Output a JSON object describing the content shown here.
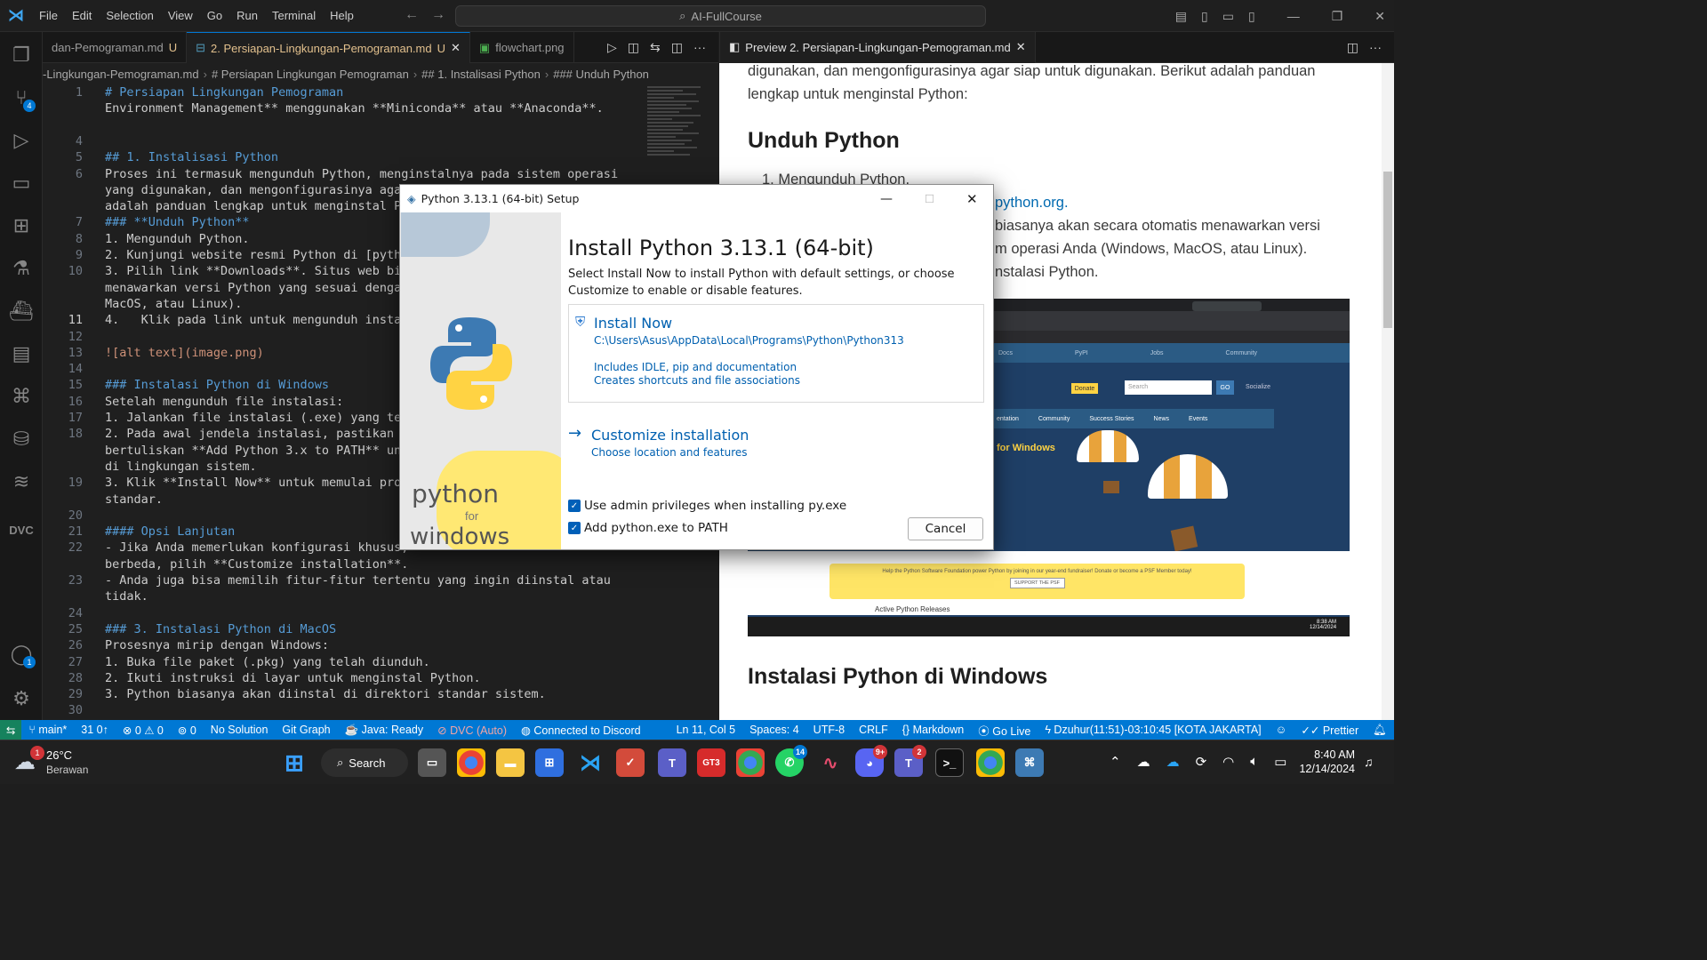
{
  "titlebar": {
    "menus": [
      "File",
      "Edit",
      "Selection",
      "View",
      "Go",
      "Run",
      "Terminal",
      "Help"
    ],
    "command_center": "AI-FullCourse"
  },
  "activity": {
    "scm_badge": "4",
    "account_badge": "1"
  },
  "editor_tabs": [
    {
      "label": "dan-Pemograman.md",
      "modified": "U",
      "active": false
    },
    {
      "label": "2. Persiapan-Lingkungan-Pemograman.md",
      "modified": "U",
      "active": true
    },
    {
      "label": "flowchart.png",
      "modified": "",
      "active": false
    }
  ],
  "breadcrumb": [
    "-Lingkungan-Pemograman.md",
    "# Persiapan Lingkungan Pemograman",
    "## 1. Instalisasi Python",
    "### Unduh Python"
  ],
  "editor": {
    "lines": [
      {
        "n": "1",
        "t": "# Persiapan Lingkungan Pemograman",
        "k": "h"
      },
      {
        "n": "",
        "t": "Environment Management** menggunakan **Miniconda** atau **Anaconda**.",
        "k": "mix1"
      },
      {
        "n": "",
        "t": "",
        "k": ""
      },
      {
        "n": "4",
        "t": "",
        "k": ""
      },
      {
        "n": "5",
        "t": "## 1. Instalisasi Python",
        "k": "h"
      },
      {
        "n": "6",
        "t": "Proses ini termasuk mengunduh Python, menginstalnya pada sistem operasi",
        "k": ""
      },
      {
        "n": "",
        "t": "yang digunakan, dan mengonfigurasinya agar siap untuk digunakan. Berikut",
        "k": ""
      },
      {
        "n": "",
        "t": "adalah panduan lengkap untuk menginstal Py",
        "k": ""
      },
      {
        "n": "7",
        "t": "### **Unduh Python**",
        "k": "h"
      },
      {
        "n": "8",
        "t": "1. Mengunduh Python.",
        "k": "li"
      },
      {
        "n": "9",
        "t": "2. Kunjungi website resmi Python di [pytho",
        "k": "li"
      },
      {
        "n": "10",
        "t": "3. Pilih link **Downloads**. Situs web bia",
        "k": "li"
      },
      {
        "n": "",
        "t": "menawarkan versi Python yang sesuai dengan",
        "k": ""
      },
      {
        "n": "",
        "t": "MacOS, atau Linux).",
        "k": ""
      },
      {
        "n": "11",
        "t": "4.   Klik pada link untuk mengunduh instal",
        "k": "li"
      },
      {
        "n": "12",
        "t": "",
        "k": ""
      },
      {
        "n": "13",
        "t": "![alt text](image.png)",
        "k": "img"
      },
      {
        "n": "14",
        "t": "",
        "k": ""
      },
      {
        "n": "15",
        "t": "### Instalasi Python di Windows",
        "k": "h"
      },
      {
        "n": "16",
        "t": "Setelah mengunduh file instalasi:",
        "k": ""
      },
      {
        "n": "17",
        "t": "1. Jalankan file instalasi (.exe) yang tel",
        "k": "li"
      },
      {
        "n": "18",
        "t": "2. Pada awal jendela instalasi, pastikan u",
        "k": "li"
      },
      {
        "n": "",
        "t": "bertuliskan **Add Python 3.x to PATH** unt",
        "k": "mix2"
      },
      {
        "n": "",
        "t": "di lingkungan sistem.",
        "k": ""
      },
      {
        "n": "19",
        "t": "3. Klik **Install Now** untuk memulai pros",
        "k": "mix3"
      },
      {
        "n": "",
        "t": "standar.",
        "k": ""
      },
      {
        "n": "20",
        "t": "",
        "k": ""
      },
      {
        "n": "21",
        "t": "#### Opsi Lanjutan",
        "k": "h"
      },
      {
        "n": "22",
        "t": "- Jika Anda memerlukan konfigurasi khusus,",
        "k": "li"
      },
      {
        "n": "",
        "t": "berbeda, pilih **Customize installation**.",
        "k": "mix4"
      },
      {
        "n": "23",
        "t": "- Anda juga bisa memilih fitur-fitur tertentu yang ingin diinstal atau",
        "k": "li"
      },
      {
        "n": "",
        "t": "tidak.",
        "k": ""
      },
      {
        "n": "24",
        "t": "",
        "k": ""
      },
      {
        "n": "25",
        "t": "### 3. Instalasi Python di MacOS",
        "k": "h"
      },
      {
        "n": "26",
        "t": "Prosesnya mirip dengan Windows:",
        "k": ""
      },
      {
        "n": "27",
        "t": "1. Buka file paket (.pkg) yang telah diunduh.",
        "k": "li"
      },
      {
        "n": "28",
        "t": "2. Ikuti instruksi di layar untuk menginstal Python.",
        "k": "li"
      },
      {
        "n": "29",
        "t": "3. Python biasanya akan diinstal di direktori standar sistem.",
        "k": "li"
      },
      {
        "n": "30",
        "t": "",
        "k": ""
      },
      {
        "n": "31",
        "t": "### 4. Instalasi Python di Linux",
        "k": "h"
      }
    ]
  },
  "preview": {
    "tab_label": "Preview 2. Persiapan-Lingkungan-Pemograman.md",
    "para1a": "digunakan, dan mengonfigurasinya agar siap untuk digunakan. Berikut adalah panduan",
    "para1b": "lengkap untuk menginstal Python:",
    "heading_unduh": "Unduh Python",
    "item1": "1. Mengunduh Python.",
    "link_text": "python.org.",
    "text_a": "biasanya akan secara otomatis menawarkan versi",
    "text_b": "m operasi Anda (Windows, MacOS, atau Linux).",
    "text_c": "nstalasi Python.",
    "heading_windows": "Instalasi Python di Windows",
    "shot": {
      "donate": "Donate",
      "search": "Search",
      "go": "GO",
      "socialize": "Socialize",
      "nav": [
        "Docs",
        "PyPI",
        "Jobs",
        "Community"
      ],
      "menu": [
        "entation",
        "Community",
        "Success Stories",
        "News",
        "Events"
      ],
      "for_windows": "for Windows",
      "banner": "Help the Python Software Foundation power Python by joining in our year-end fundraiser! Donate or become a PSF Member today!",
      "support": "SUPPORT THE PSF",
      "releases": "Active Python Releases",
      "time": "8:38 AM",
      "date": "12/14/2024"
    }
  },
  "dialog": {
    "title": "Python 3.13.1 (64-bit) Setup",
    "heading": "Install Python 3.13.1 (64-bit)",
    "description": "Select Install Now to install Python with default settings, or choose Customize to enable or disable features.",
    "install_now": "Install Now",
    "install_path": "C:\\Users\\Asus\\AppData\\Local\\Programs\\Python\\Python313",
    "install_info1": "Includes IDLE, pip and documentation",
    "install_info2": "Creates shortcuts and file associations",
    "customize": "Customize installation",
    "customize_sub": "Choose location and features",
    "check1": "Use admin privileges when installing py.exe",
    "check2": "Add python.exe to PATH",
    "cancel": "Cancel",
    "side_brand1": "python",
    "side_brand2": "for",
    "side_brand3": "windows"
  },
  "statusbar": {
    "branch": "main*",
    "sync": "31 0↑",
    "problems": "⊗ 0 ⚠ 0",
    "ports": "0",
    "solution": "No Solution",
    "git_graph": "Git Graph",
    "java": "Java: Ready",
    "dvc": "DVC (Auto)",
    "discord": "Connected to Discord",
    "position": "Ln 11, Col 5",
    "spaces": "Spaces: 4",
    "encoding": "UTF-8",
    "eol": "CRLF",
    "language": "Markdown",
    "golive": "Go Live",
    "prayer": "Dzuhur(11:51)-03:10:45 [KOTA JAKARTA]",
    "prettier": "Prettier"
  },
  "taskbar": {
    "weather_temp": "26°C",
    "weather_desc": "Berawan",
    "weather_badge": "1",
    "search": "Search",
    "time": "8:40 AM",
    "date": "12/14/2024",
    "badges": {
      "whatsapp": "14",
      "discord": "9+",
      "teams": "2"
    }
  }
}
